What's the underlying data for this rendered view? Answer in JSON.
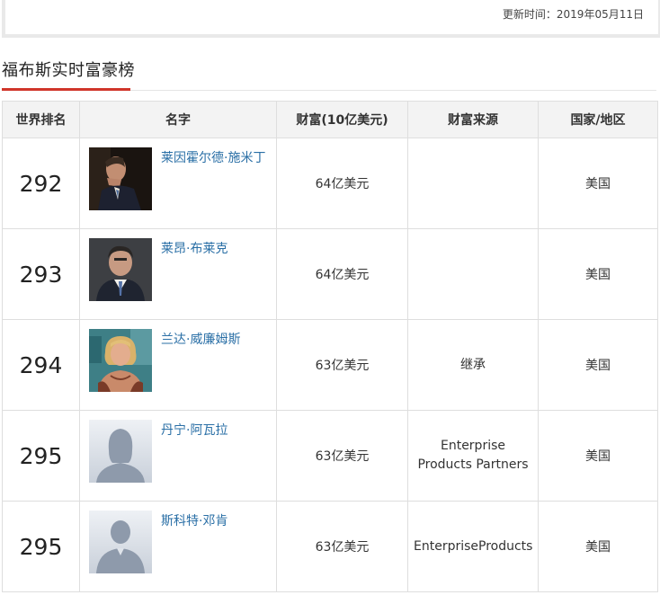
{
  "header": {
    "update_label": "更新时间：2019年05月11日"
  },
  "section": {
    "title": "福布斯实时富豪榜"
  },
  "table": {
    "headers": {
      "rank": "世界排名",
      "name": "名字",
      "wealth": "财富(10亿美元)",
      "source": "财富来源",
      "country": "国家/地区"
    },
    "rows": [
      {
        "rank": "292",
        "name": "莱因霍尔德·施米丁",
        "wealth": "64亿美元",
        "source": "",
        "country": "美国",
        "photo": "photo-profile-man-icon"
      },
      {
        "rank": "293",
        "name": "莱昂·布莱克",
        "wealth": "64亿美元",
        "source": "",
        "country": "美国",
        "photo": "photo-man-suit-icon"
      },
      {
        "rank": "294",
        "name": "兰达·威廉姆斯",
        "wealth": "63亿美元",
        "source": "继承",
        "country": "美国",
        "photo": "photo-woman-blonde-icon"
      },
      {
        "rank": "295",
        "name": "丹宁·阿瓦拉",
        "wealth": "63亿美元",
        "source": "Enterprise Products Partners",
        "country": "美国",
        "photo": "placeholder-female-avatar-icon"
      },
      {
        "rank": "295",
        "name": "斯科特·邓肯",
        "wealth": "63亿美元",
        "source": "EnterpriseProducts",
        "country": "美国",
        "photo": "placeholder-male-avatar-icon"
      }
    ]
  }
}
